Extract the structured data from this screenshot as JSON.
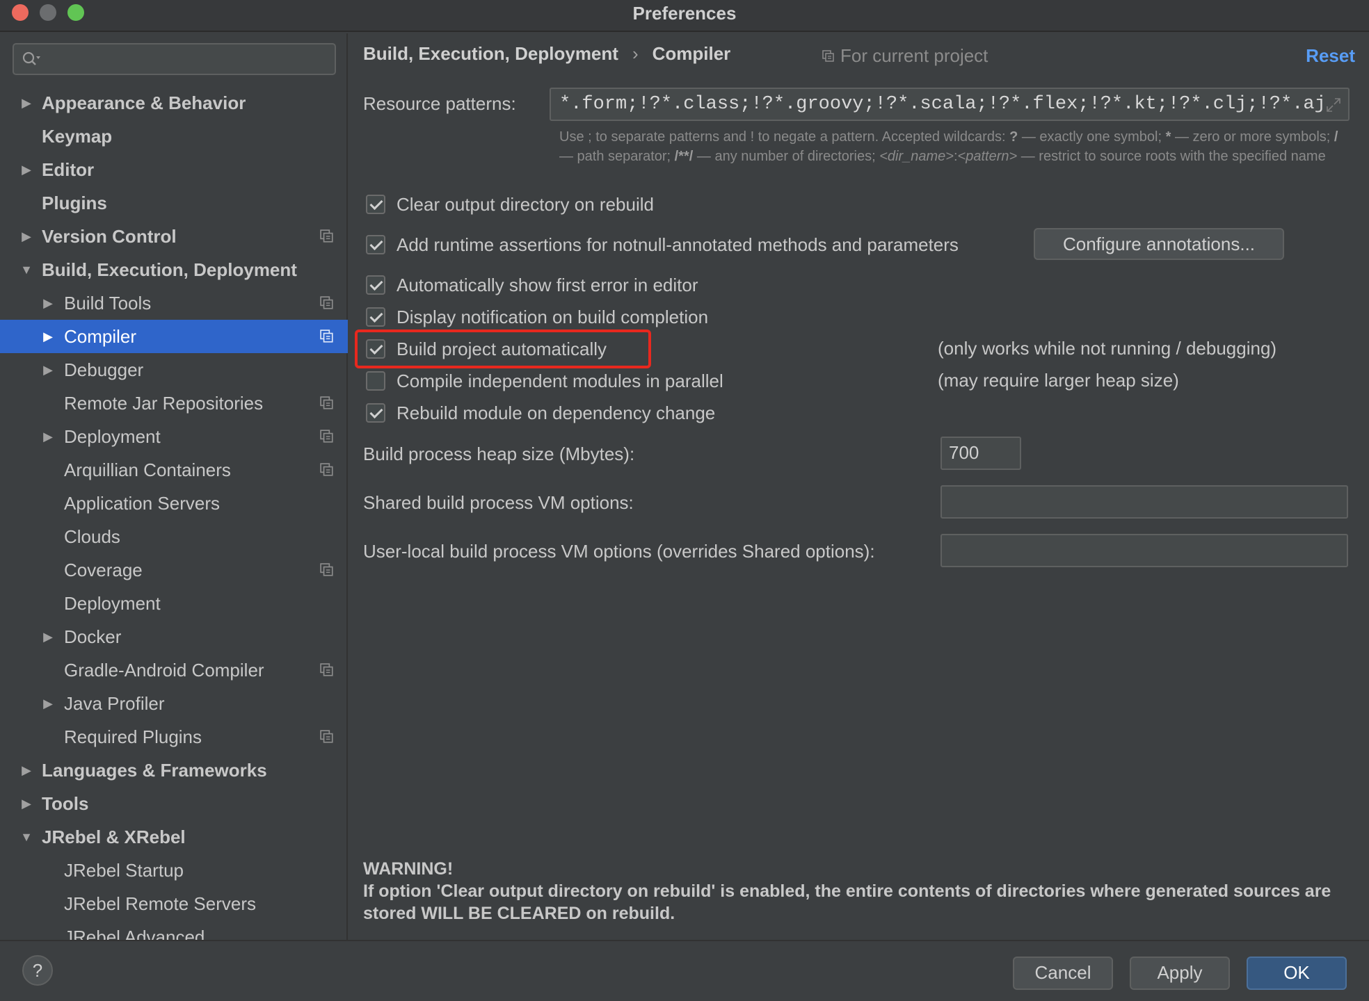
{
  "window": {
    "title": "Preferences"
  },
  "search": {
    "placeholder": ""
  },
  "sidebar": {
    "items": [
      {
        "label": "Appearance & Behavior",
        "level": 0,
        "bold": true,
        "arrow": "▶",
        "proj": false
      },
      {
        "label": "Keymap",
        "level": 0,
        "bold": true,
        "arrow": "",
        "proj": false
      },
      {
        "label": "Editor",
        "level": 0,
        "bold": true,
        "arrow": "▶",
        "proj": false
      },
      {
        "label": "Plugins",
        "level": 0,
        "bold": true,
        "arrow": "",
        "proj": false
      },
      {
        "label": "Version Control",
        "level": 0,
        "bold": true,
        "arrow": "▶",
        "proj": true
      },
      {
        "label": "Build, Execution, Deployment",
        "level": 0,
        "bold": true,
        "arrow": "▼",
        "proj": false
      },
      {
        "label": "Build Tools",
        "level": 1,
        "bold": false,
        "arrow": "▶",
        "proj": true
      },
      {
        "label": "Compiler",
        "level": 1,
        "bold": false,
        "arrow": "▶",
        "proj": true,
        "selected": true
      },
      {
        "label": "Debugger",
        "level": 1,
        "bold": false,
        "arrow": "▶",
        "proj": false
      },
      {
        "label": "Remote Jar Repositories",
        "level": 1,
        "bold": false,
        "arrow": "",
        "proj": true
      },
      {
        "label": "Deployment",
        "level": 1,
        "bold": false,
        "arrow": "▶",
        "proj": true
      },
      {
        "label": "Arquillian Containers",
        "level": 1,
        "bold": false,
        "arrow": "",
        "proj": true
      },
      {
        "label": "Application Servers",
        "level": 1,
        "bold": false,
        "arrow": "",
        "proj": false
      },
      {
        "label": "Clouds",
        "level": 1,
        "bold": false,
        "arrow": "",
        "proj": false
      },
      {
        "label": "Coverage",
        "level": 1,
        "bold": false,
        "arrow": "",
        "proj": true
      },
      {
        "label": "Deployment",
        "level": 1,
        "bold": false,
        "arrow": "",
        "proj": false
      },
      {
        "label": "Docker",
        "level": 1,
        "bold": false,
        "arrow": "▶",
        "proj": false
      },
      {
        "label": "Gradle-Android Compiler",
        "level": 1,
        "bold": false,
        "arrow": "",
        "proj": true
      },
      {
        "label": "Java Profiler",
        "level": 1,
        "bold": false,
        "arrow": "▶",
        "proj": false
      },
      {
        "label": "Required Plugins",
        "level": 1,
        "bold": false,
        "arrow": "",
        "proj": true
      },
      {
        "label": "Languages & Frameworks",
        "level": 0,
        "bold": true,
        "arrow": "▶",
        "proj": false
      },
      {
        "label": "Tools",
        "level": 0,
        "bold": true,
        "arrow": "▶",
        "proj": false
      },
      {
        "label": "JRebel & XRebel",
        "level": 0,
        "bold": true,
        "arrow": "▼",
        "proj": false
      },
      {
        "label": "JRebel Startup",
        "level": 1,
        "bold": false,
        "arrow": "",
        "proj": false
      },
      {
        "label": "JRebel Remote Servers",
        "level": 1,
        "bold": false,
        "arrow": "",
        "proj": false
      },
      {
        "label": "JRebel Advanced",
        "level": 1,
        "bold": false,
        "arrow": "",
        "proj": false
      }
    ]
  },
  "header": {
    "breadcrumb_parent": "Build, Execution, Deployment",
    "breadcrumb_sep": "›",
    "breadcrumb_current": "Compiler",
    "scope": "For current project",
    "reset": "Reset"
  },
  "resource": {
    "label": "Resource patterns:",
    "value": "*.form;!?*.class;!?*.groovy;!?*.scala;!?*.flex;!?*.kt;!?*.clj;!?*.aj",
    "help_1": "Use ; to separate patterns and ! to negate a pattern. Accepted wildcards: ",
    "help_q": "?",
    "help_2": " — exactly one symbol; ",
    "help_star": "*",
    "help_3": " — zero or more symbols; ",
    "help_slash": "/",
    "help_4": " — path separator; ",
    "help_dstar": "/**/",
    "help_5": " — any number of directories; ",
    "help_dir": "<dir_name>",
    "help_colon": ":",
    "help_pat": "<pattern>",
    "help_6": " — restrict to source roots with the specified name"
  },
  "options": {
    "clear_output": {
      "label": "Clear output directory on rebuild",
      "checked": true
    },
    "runtime_assertions": {
      "label": "Add runtime assertions for notnull-annotated methods and parameters",
      "checked": true
    },
    "configure_annotations": "Configure annotations...",
    "show_first_error": {
      "label": "Automatically show first error in editor",
      "checked": true
    },
    "display_notification": {
      "label": "Display notification on build completion",
      "checked": true
    },
    "build_automatically": {
      "label": "Build project automatically",
      "checked": true,
      "note": "(only works while not running / debugging)"
    },
    "compile_parallel": {
      "label": "Compile independent modules in parallel",
      "checked": false,
      "note": "(may require larger heap size)"
    },
    "rebuild_on_dependency": {
      "label": "Rebuild module on dependency change",
      "checked": true
    }
  },
  "fields": {
    "heap_label": "Build process heap size (Mbytes):",
    "heap_value": "700",
    "shared_vm_label": "Shared build process VM options:",
    "shared_vm_value": "",
    "user_vm_label": "User-local build process VM options (overrides Shared options):",
    "user_vm_value": ""
  },
  "warning": {
    "title": "WARNING!",
    "text": "If option 'Clear output directory on rebuild' is enabled, the entire contents of directories where generated sources are stored WILL BE CLEARED on rebuild."
  },
  "footer": {
    "help": "?",
    "cancel": "Cancel",
    "apply": "Apply",
    "ok": "OK"
  },
  "colors": {
    "selection": "#2f65ca",
    "link": "#589df6",
    "highlight": "#e8281e",
    "primary_button": "#365880"
  }
}
